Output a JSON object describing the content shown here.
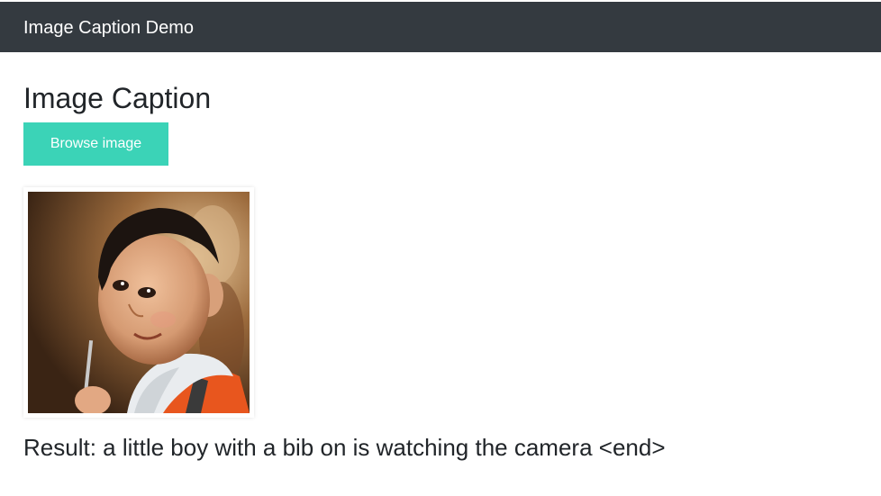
{
  "navbar": {
    "brand": "Image Caption Demo"
  },
  "main": {
    "title": "Image Caption",
    "browse_label": "Browse image",
    "result_text": "Result: a little boy with a bib on is watching the camera <end>"
  }
}
